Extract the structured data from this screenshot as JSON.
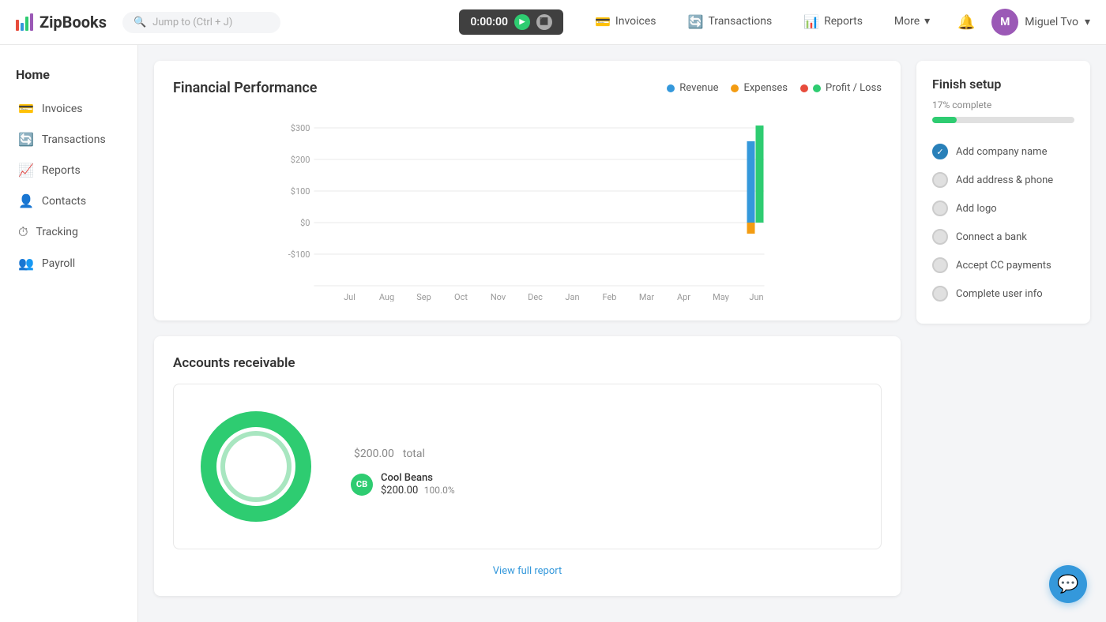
{
  "app": {
    "name": "ZipBooks"
  },
  "header": {
    "search_placeholder": "Jump to (Ctrl + J)",
    "timer": "0:00:00",
    "nav_items": [
      {
        "id": "invoices",
        "label": "Invoices",
        "icon": "💳"
      },
      {
        "id": "transactions",
        "label": "Transactions",
        "icon": "🔄"
      },
      {
        "id": "reports",
        "label": "Reports",
        "icon": "📊"
      },
      {
        "id": "more",
        "label": "More",
        "icon": ""
      }
    ],
    "user_initial": "M",
    "user_name": "Miguel Tvo"
  },
  "sidebar": {
    "home_label": "Home",
    "items": [
      {
        "id": "invoices",
        "label": "Invoices"
      },
      {
        "id": "transactions",
        "label": "Transactions"
      },
      {
        "id": "reports",
        "label": "Reports"
      },
      {
        "id": "contacts",
        "label": "Contacts"
      },
      {
        "id": "tracking",
        "label": "Tracking"
      },
      {
        "id": "payroll",
        "label": "Payroll"
      }
    ]
  },
  "chart": {
    "title": "Financial Performance",
    "legend": [
      {
        "id": "revenue",
        "label": "Revenue",
        "color": "#3498db"
      },
      {
        "id": "expenses",
        "label": "Expenses",
        "color": "#f39c12"
      },
      {
        "id": "profit",
        "label": "Profit / Loss",
        "color": "#2ecc71"
      }
    ],
    "x_labels": [
      "Jul",
      "Aug",
      "Sep",
      "Oct",
      "Nov",
      "Dec",
      "Jan",
      "Feb",
      "Mar",
      "Apr",
      "May",
      "Jun"
    ],
    "y_labels": [
      "$300",
      "$200",
      "$100",
      "$0",
      "-$100"
    ],
    "progress_pct": 17
  },
  "accounts_receivable": {
    "title": "Accounts receivable",
    "total": "$200.00",
    "total_label": "total",
    "view_report": "View full report",
    "items": [
      {
        "initials": "CB",
        "name": "Cool Beans",
        "amount": "$200.00",
        "pct": "100.0%"
      }
    ]
  },
  "setup": {
    "title": "Finish setup",
    "progress_text": "17% complete",
    "progress_pct": 17,
    "items": [
      {
        "id": "company",
        "label": "Add company name",
        "done": true
      },
      {
        "id": "address",
        "label": "Add address & phone",
        "done": false
      },
      {
        "id": "logo",
        "label": "Add logo",
        "done": false
      },
      {
        "id": "bank",
        "label": "Connect a bank",
        "done": false
      },
      {
        "id": "cc",
        "label": "Accept CC payments",
        "done": false
      },
      {
        "id": "userinfo",
        "label": "Complete user info",
        "done": false
      }
    ]
  }
}
